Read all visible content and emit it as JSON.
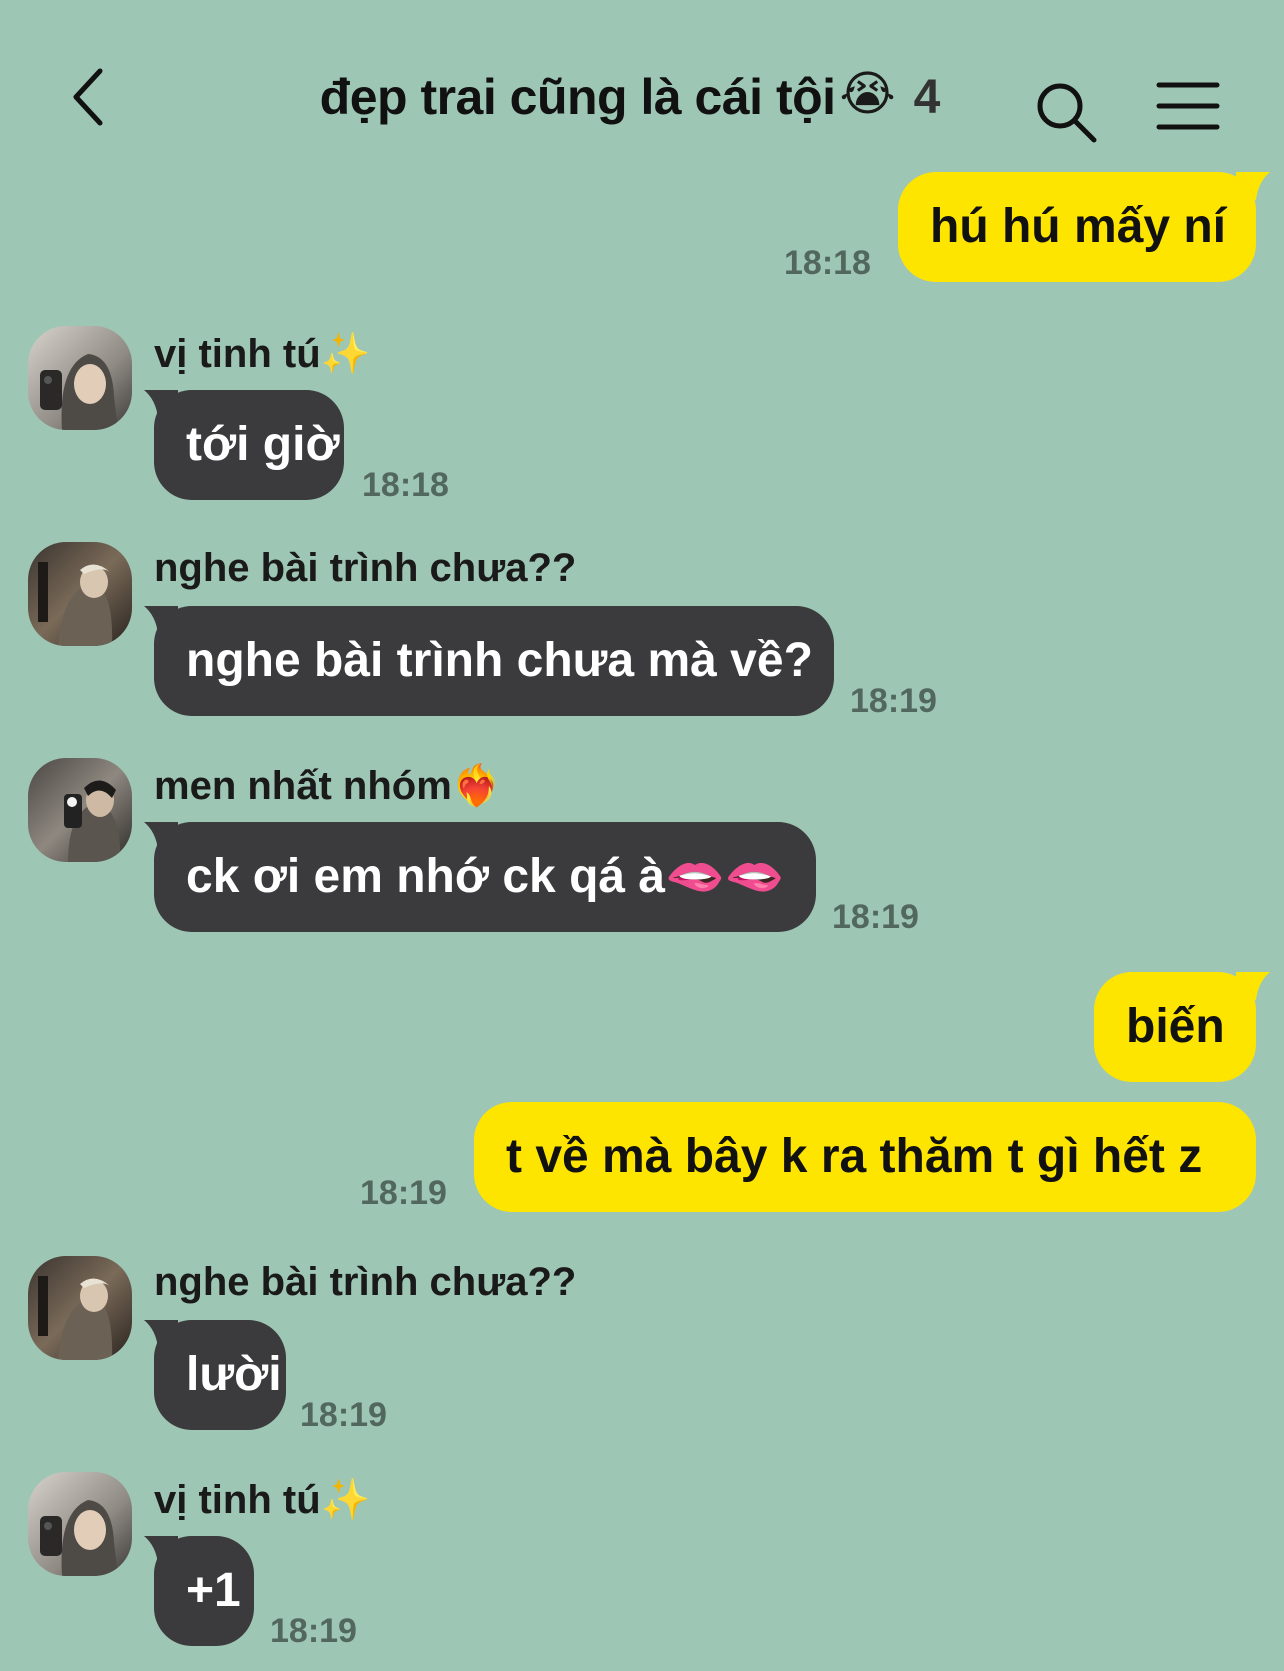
{
  "header": {
    "title": "đẹp trai cũng là cái tội",
    "title_emoji": "😭",
    "member_count": "4",
    "back_icon": "chevron-left-icon",
    "search_icon": "search-icon",
    "menu_icon": "hamburger-menu-icon"
  },
  "colors": {
    "background": "#9ec6b4",
    "outgoing_bubble": "#fee500",
    "incoming_bubble": "#3b3a3c",
    "timestamp": "#52685e"
  },
  "messages": [
    {
      "direction": "out",
      "text": "hú hú mấy ní",
      "time": "18:18"
    },
    {
      "direction": "in",
      "sender": "vị tinh tú",
      "sender_emoji": "✨",
      "text": "tới giờ",
      "time": "18:18"
    },
    {
      "direction": "in",
      "sender": "nghe bài trình chưa??",
      "sender_emoji": "",
      "text": "nghe bài trình chưa mà về?",
      "time": "18:19"
    },
    {
      "direction": "in",
      "sender": "men nhất nhóm",
      "sender_emoji": "❤️‍🔥",
      "text": "ck ơi em nhớ ck qá à",
      "text_emoji": "🫦🫦",
      "time": "18:19"
    },
    {
      "direction": "out",
      "text": "biến",
      "time": ""
    },
    {
      "direction": "out",
      "text": "t về mà bây k ra thăm t gì hết z",
      "time": "18:19"
    },
    {
      "direction": "in",
      "sender": "nghe bài trình chưa??",
      "sender_emoji": "",
      "text": "lười",
      "time": "18:19"
    },
    {
      "direction": "in",
      "sender": "vị tinh tú",
      "sender_emoji": "✨",
      "text": "+1",
      "time": "18:19"
    }
  ]
}
